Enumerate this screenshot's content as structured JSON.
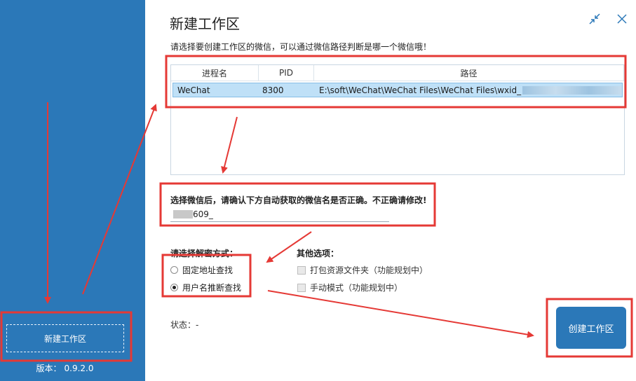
{
  "sidebar": {
    "new_workspace_label": "新建工作区",
    "version_label": "版本：",
    "version_value": "0.9.2.0"
  },
  "dialog": {
    "title": "新建工作区",
    "instruction": "请选择要创建工作区的微信，可以通过微信路径判断是哪一个微信哦！",
    "columns": [
      "进程名",
      "PID",
      "路径"
    ],
    "rows": [
      {
        "process": "WeChat",
        "pid": "8300",
        "path": "E:\\soft\\WeChat\\WeChat Files\\WeChat Files\\wxid_"
      }
    ],
    "confirm_label": "选择微信后，请确认下方自动获取的微信名是否正确。不正确请修改!",
    "wechat_name_value": "609_",
    "decrypt_section_label": "请选择解密方式：",
    "decrypt_options": [
      {
        "label": "固定地址查找",
        "selected": false
      },
      {
        "label": "用户名推断查找",
        "selected": true
      }
    ],
    "other_section_label": "其他选项：",
    "other_options": [
      {
        "label": "打包资源文件夹（功能规划中）",
        "checked": false
      },
      {
        "label": "手动模式（功能规划中）",
        "checked": false
      }
    ],
    "status_label": "状态：",
    "status_value": "-",
    "create_button_label": "创建工作区"
  },
  "colors": {
    "sidebar": "#2b78b8",
    "accent": "#2b78b8",
    "annotation": "#e53935",
    "selected_row": "#bfe0f7"
  }
}
